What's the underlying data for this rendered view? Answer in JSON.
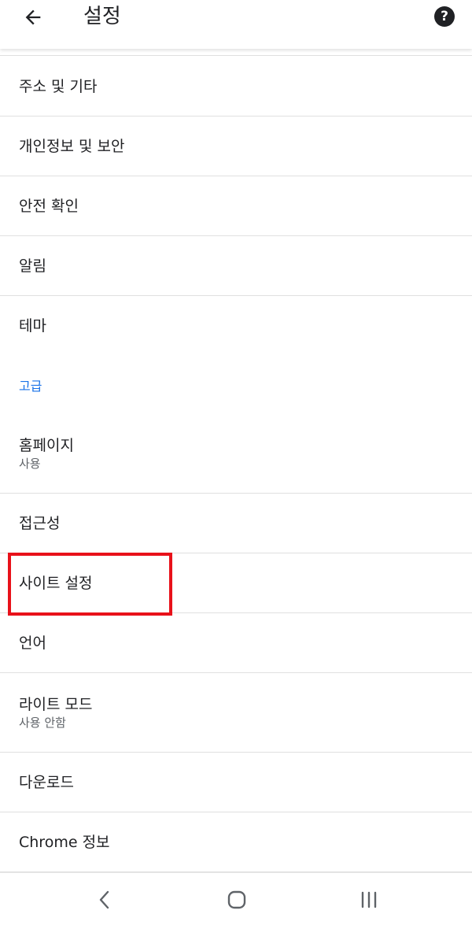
{
  "appbar": {
    "title": "설정",
    "back_icon": "arrow-left-icon",
    "help_icon": "help-icon",
    "help_glyph": "?"
  },
  "items": [
    {
      "title": "주소 및 기타"
    },
    {
      "title": "개인정보 및 보안"
    },
    {
      "title": "안전 확인"
    },
    {
      "title": "알림"
    },
    {
      "title": "테마"
    }
  ],
  "section_advanced": "고급",
  "advanced_items": [
    {
      "title": "홈페이지",
      "subtitle": "사용"
    },
    {
      "title": "접근성"
    },
    {
      "title": "사이트 설정"
    },
    {
      "title": "언어"
    },
    {
      "title": "라이트 모드",
      "subtitle": "사용 안함"
    },
    {
      "title": "다운로드"
    },
    {
      "title": "Chrome 정보"
    }
  ],
  "highlight": {
    "target": "사이트 설정",
    "color": "#e8111a"
  },
  "colors": {
    "accent": "#1a73e8",
    "divider": "#e0e0e0",
    "text": "#202124",
    "secondary": "#5f6368"
  },
  "navbar": {
    "back_icon": "nav-back-icon",
    "home_icon": "nav-home-icon",
    "recents_icon": "nav-recents-icon"
  }
}
